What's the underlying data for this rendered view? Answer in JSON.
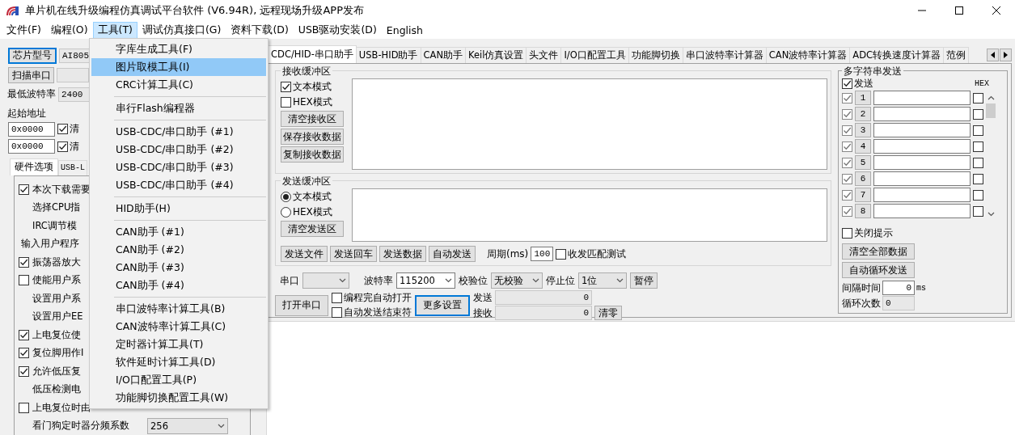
{
  "window": {
    "title": "单片机在线升级编程仿真调试平台软件 (V6.94R), 远程现场升级APP发布"
  },
  "menu_bar": [
    {
      "label": "文件(F)",
      "selected": false
    },
    {
      "label": "编程(O)",
      "selected": false
    },
    {
      "label": "工具(T)",
      "selected": true
    },
    {
      "label": "调试仿真接口(G)",
      "selected": false
    },
    {
      "label": "资料下载(D)",
      "selected": false
    },
    {
      "label": "USB驱动安装(D)",
      "selected": false
    },
    {
      "label": "English",
      "selected": false
    }
  ],
  "tools_menu": {
    "groups": [
      [
        {
          "label": "字库生成工具(F)",
          "selected": false
        },
        {
          "label": "图片取模工具(I)",
          "selected": true
        },
        {
          "label": "CRC计算工具(C)",
          "selected": false
        }
      ],
      [
        {
          "label": "串行Flash编程器",
          "selected": false
        }
      ],
      [
        {
          "label": "USB-CDC/串口助手 (#1)",
          "selected": false
        },
        {
          "label": "USB-CDC/串口助手 (#2)",
          "selected": false
        },
        {
          "label": "USB-CDC/串口助手 (#3)",
          "selected": false
        },
        {
          "label": "USB-CDC/串口助手 (#4)",
          "selected": false
        }
      ],
      [
        {
          "label": "HID助手(H)",
          "selected": false
        }
      ],
      [
        {
          "label": "CAN助手 (#1)",
          "selected": false
        },
        {
          "label": "CAN助手 (#2)",
          "selected": false
        },
        {
          "label": "CAN助手 (#3)",
          "selected": false
        },
        {
          "label": "CAN助手 (#4)",
          "selected": false
        }
      ],
      [
        {
          "label": "串口波特率计算工具(B)",
          "selected": false
        },
        {
          "label": "CAN波特率计算工具(C)",
          "selected": false
        },
        {
          "label": "定时器计算工具(T)",
          "selected": false
        },
        {
          "label": "软件延时计算工具(D)",
          "selected": false
        },
        {
          "label": "I/O口配置工具(P)",
          "selected": false
        },
        {
          "label": "功能脚切换配置工具(W)",
          "selected": false
        }
      ]
    ]
  },
  "left_panel": {
    "chip_button": "芯片型号",
    "chip_value": "AI805",
    "scan_button": "扫描串口",
    "min_baud_label": "最低波特率",
    "min_baud_value": "2400",
    "start_address_label": "起始地址",
    "address_rows": [
      {
        "value": "0x0000",
        "checked": true,
        "label": "清"
      },
      {
        "value": "0x0000",
        "checked": true,
        "label": "清"
      }
    ],
    "tabs": [
      {
        "label": "硬件选项",
        "selected": true
      },
      {
        "label": "USB-L",
        "selected": false
      }
    ],
    "options": [
      {
        "kind": "check",
        "label": "本次下载需要",
        "checked": true
      },
      {
        "kind": "label",
        "label": "选择CPU指"
      },
      {
        "kind": "label",
        "label": "IRC调节模"
      },
      {
        "kind": "heading",
        "label": "输入用户程序"
      },
      {
        "kind": "check",
        "label": "振荡器放大",
        "checked": true
      },
      {
        "kind": "check",
        "label": "使能用户系",
        "checked": false
      },
      {
        "kind": "label",
        "label": "设置用户系"
      },
      {
        "kind": "label",
        "label": "设置用户EE"
      },
      {
        "kind": "check",
        "label": "上电复位使",
        "checked": true
      },
      {
        "kind": "check",
        "label": "复位脚用作I",
        "checked": true
      },
      {
        "kind": "check",
        "label": "允许低压复",
        "checked": true
      },
      {
        "kind": "label",
        "label": "低压检测电"
      },
      {
        "kind": "check",
        "label": "上电复位时由",
        "checked": false
      },
      {
        "kind": "select",
        "label": "看门狗定时器分频系数",
        "value": "256"
      }
    ]
  },
  "tabs": [
    {
      "label": "CDC/HID-串口助手",
      "selected": true
    },
    {
      "label": "USB-HID助手",
      "selected": false
    },
    {
      "label": "CAN助手",
      "selected": false
    },
    {
      "label": "Keil仿真设置",
      "selected": false
    },
    {
      "label": "头文件",
      "selected": false
    },
    {
      "label": "I/O口配置工具",
      "selected": false
    },
    {
      "label": "功能脚切换",
      "selected": false
    },
    {
      "label": "串口波特率计算器",
      "selected": false
    },
    {
      "label": "CAN波特率计算器",
      "selected": false
    },
    {
      "label": "ADC转换速度计算器",
      "selected": false
    },
    {
      "label": "范例",
      "selected": false
    }
  ],
  "receive": {
    "title": "接收缓冲区",
    "modes": [
      {
        "label": "文本模式",
        "checked": true
      },
      {
        "label": "HEX模式",
        "checked": false
      }
    ],
    "buttons": [
      "清空接收区",
      "保存接收数据",
      "复制接收数据"
    ]
  },
  "send": {
    "title": "发送缓冲区",
    "modes": [
      {
        "label": "文本模式",
        "selected": true
      },
      {
        "label": "HEX模式",
        "selected": false
      }
    ],
    "buttons": [
      "清空发送区"
    ],
    "action_buttons": [
      "发送文件",
      "发送回车",
      "发送数据",
      "自动发送"
    ],
    "period_label": "周期(ms)",
    "period_value": "100",
    "match_test": {
      "label": "收发匹配测试",
      "checked": false
    }
  },
  "serial": {
    "port_label": "串口",
    "baud_label": "波特率",
    "baud_value": "115200",
    "parity_label": "校验位",
    "parity_value": "无校验",
    "stop_label": "停止位",
    "stop_value": "1位",
    "pause_button": "暂停",
    "open_button": "打开串口",
    "options": [
      {
        "label": "编程完自动打开",
        "checked": false
      },
      {
        "label": "自动发送结束符",
        "checked": false
      }
    ],
    "more_button": "更多设置",
    "counters": [
      {
        "label": "发送",
        "value": "0"
      },
      {
        "label": "接收",
        "value": "0"
      }
    ],
    "clear_button": "清零"
  },
  "multi_send": {
    "title": "多字符串发送",
    "send_all": {
      "label": "发送",
      "checked": true
    },
    "hex_label": "HEX",
    "rows": [
      {
        "number": "1",
        "checked": true,
        "hex": false
      },
      {
        "number": "2",
        "checked": true,
        "hex": false
      },
      {
        "number": "3",
        "checked": true,
        "hex": false
      },
      {
        "number": "4",
        "checked": true,
        "hex": false
      },
      {
        "number": "5",
        "checked": true,
        "hex": false
      },
      {
        "number": "6",
        "checked": true,
        "hex": false
      },
      {
        "number": "7",
        "checked": true,
        "hex": false
      },
      {
        "number": "8",
        "checked": true,
        "hex": false
      }
    ],
    "close_hint": {
      "label": "关闭提示",
      "checked": false
    },
    "buttons": [
      "清空全部数据",
      "自动循环发送"
    ],
    "interval_label": "间隔时间",
    "interval_value": "0",
    "interval_unit": "ms",
    "loop_label": "循环次数",
    "loop_value": "0"
  }
}
